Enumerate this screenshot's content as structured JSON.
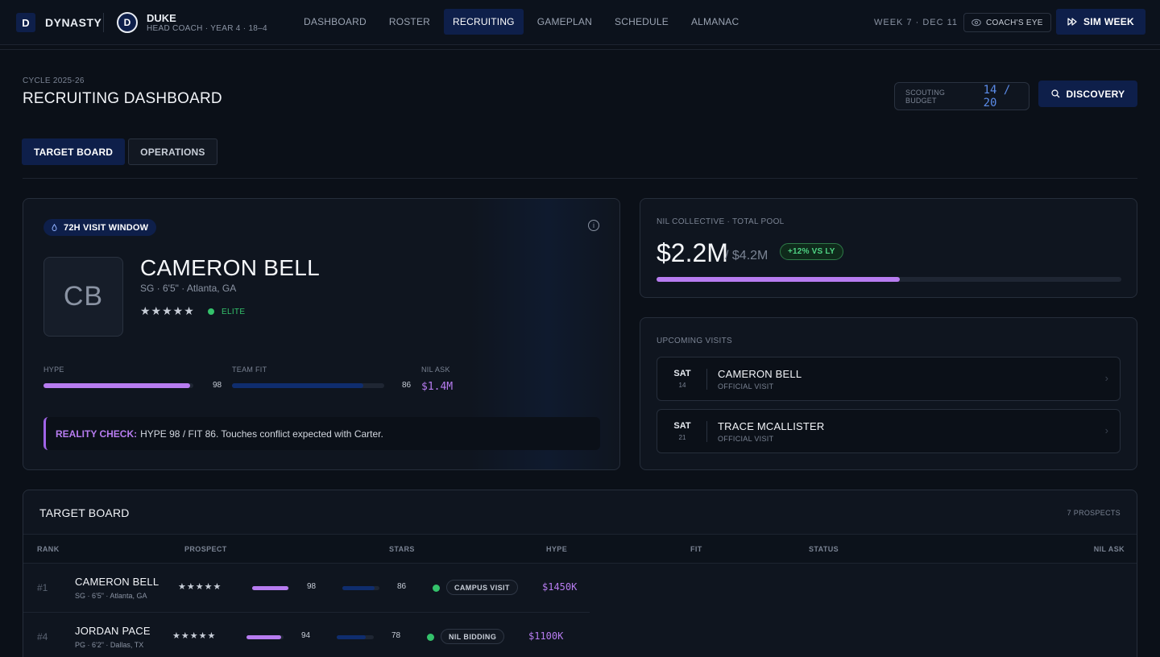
{
  "app": {
    "logo_letter": "D",
    "name": "DYNASTY",
    "team_letter": "D",
    "team_name": "DUKE",
    "team_sub": "HEAD COACH · YEAR 4 · 18–4"
  },
  "nav": [
    {
      "label": "DASHBOARD",
      "active": false
    },
    {
      "label": "ROSTER",
      "active": false
    },
    {
      "label": "RECRUITING",
      "active": true
    },
    {
      "label": "GAMEPLAN",
      "active": false
    },
    {
      "label": "SCHEDULE",
      "active": false
    },
    {
      "label": "ALMANAC",
      "active": false
    }
  ],
  "topbar": {
    "week": "WEEK 7 · DEC 11",
    "coach_eye": "COACH'S EYE",
    "sim_week": "SIM WEEK"
  },
  "header": {
    "cycle": "CYCLE 2025-26",
    "title": "RECRUITING DASHBOARD",
    "budget_label": "SCOUTING BUDGET",
    "budget_value": "14 / 20",
    "discovery": "DISCOVERY"
  },
  "tabs": [
    {
      "label": "TARGET BOARD",
      "active": true
    },
    {
      "label": "OPERATIONS",
      "active": false
    }
  ],
  "featured": {
    "pill": "72H VISIT WINDOW",
    "initials": "CB",
    "name": "CAMERON BELL",
    "meta": "SG · 6'5\" · Atlanta, GA",
    "stars": "★★★★★",
    "tier": "ELITE",
    "hype_label": "HYPE",
    "hype": 98,
    "fit_label": "TEAM FIT",
    "fit": 86,
    "nil_label": "NIL ASK",
    "nil_ask": "$1.4M",
    "reality_label": "REALITY CHECK:",
    "reality_text": "HYPE 98 / FIT 86. Touches conflict expected with Carter."
  },
  "nil": {
    "label": "NIL COLLECTIVE · TOTAL POOL",
    "value": "$2.2M",
    "total": "/ $4.2M",
    "badge": "+12% VS LY",
    "used_fraction": 0.524
  },
  "visits": {
    "label": "UPCOMING VISITS",
    "items": [
      {
        "day": "SAT",
        "date": "14",
        "name": "CAMERON BELL",
        "type": "OFFICIAL VISIT"
      },
      {
        "day": "SAT",
        "date": "21",
        "name": "TRACE MCALLISTER",
        "type": "OFFICIAL VISIT"
      }
    ]
  },
  "board": {
    "title": "TARGET BOARD",
    "count": "7 PROSPECTS",
    "columns": [
      "RANK",
      "PROSPECT",
      "STARS",
      "HYPE",
      "FIT",
      "STATUS",
      "NIL ASK"
    ],
    "rows": [
      {
        "rank": "#1",
        "name": "CAMERON BELL",
        "meta": "SG · 6'5\" · Atlanta, GA",
        "stars": "★★★★★",
        "hype": 98,
        "fit": 86,
        "status": "CAMPUS VISIT",
        "ask": "$1450K"
      },
      {
        "rank": "#4",
        "name": "JORDAN PACE",
        "meta": "PG · 6'2\" · Dallas, TX",
        "stars": "★★★★★",
        "hype": 94,
        "fit": 78,
        "status": "NIL BIDDING",
        "ask": "$1100K"
      }
    ]
  },
  "colors": {
    "accent_navy": "#0e1f4a",
    "purple": "#b77cf0",
    "green": "#34c26b",
    "fit_blue": "#0f2d6e"
  }
}
